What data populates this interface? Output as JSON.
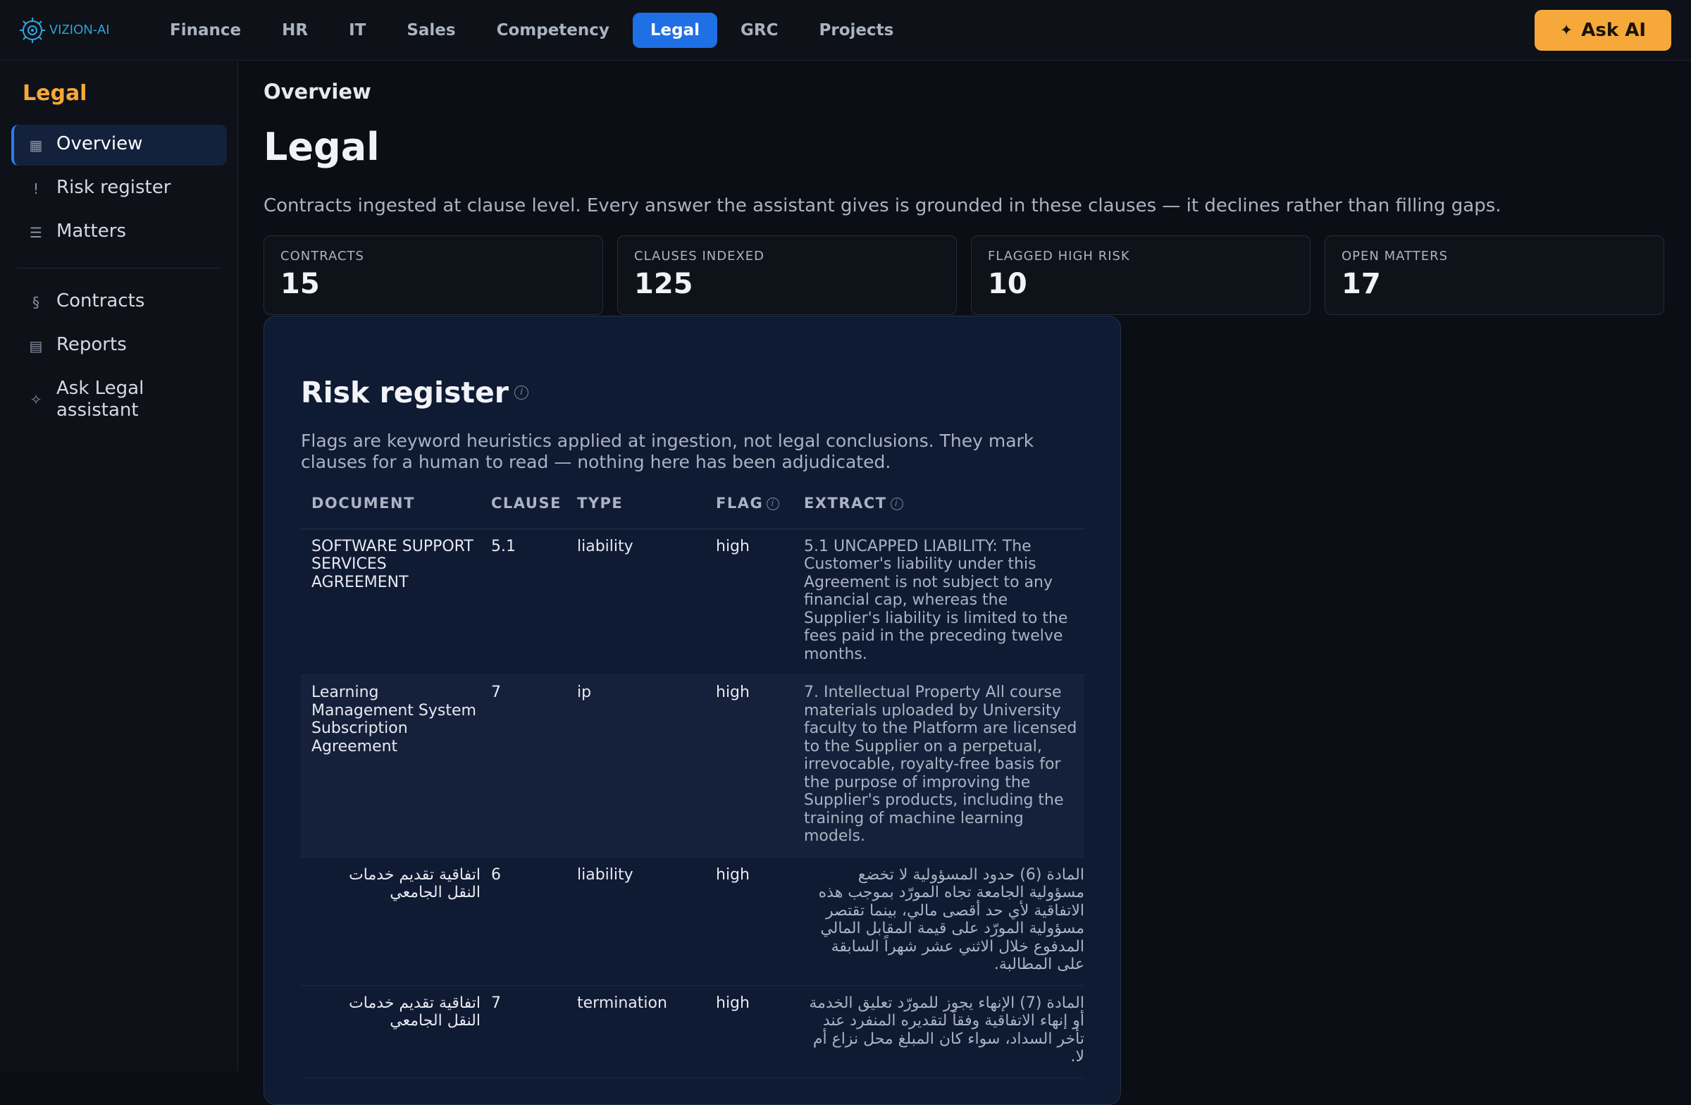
{
  "app": {
    "logo_text": "VIZION-AI"
  },
  "topnav": {
    "items": [
      {
        "label": "Finance"
      },
      {
        "label": "HR"
      },
      {
        "label": "IT"
      },
      {
        "label": "Sales"
      },
      {
        "label": "Competency"
      },
      {
        "label": "Legal",
        "active": true
      },
      {
        "label": "GRC"
      },
      {
        "label": "Projects"
      }
    ],
    "ask_ai_label": "Ask AI",
    "ask_ai_icon": "sparkle-icon"
  },
  "sidebar": {
    "title": "Legal",
    "items": [
      {
        "label": "Overview",
        "icon": "grid-icon",
        "active": true
      },
      {
        "label": "Risk register",
        "icon": "alert-icon"
      },
      {
        "label": "Matters",
        "icon": "list-icon"
      },
      {
        "label": "Contracts",
        "icon": "section-icon"
      },
      {
        "label": "Reports",
        "icon": "report-icon"
      },
      {
        "label": "Ask Legal assistant",
        "icon": "sparkle-icon"
      }
    ]
  },
  "main": {
    "breadcrumb": "Overview",
    "title": "Legal",
    "subtitle": "Contracts ingested at clause level. Every answer the assistant gives is grounded in these clauses — it declines rather than filling gaps.",
    "stats": [
      {
        "label": "CONTRACTS",
        "value": "15"
      },
      {
        "label": "CLAUSES INDEXED",
        "value": "125"
      },
      {
        "label": "FLAGGED HIGH RISK",
        "value": "10"
      },
      {
        "label": "OPEN MATTERS",
        "value": "17"
      }
    ]
  },
  "risk_register": {
    "title": "Risk register",
    "description": "Flags are keyword heuristics applied at ingestion, not legal conclusions. They mark clauses for a human to read — nothing here has been adjudicated.",
    "columns": {
      "document": "DOCUMENT",
      "clause": "CLAUSE",
      "type": "TYPE",
      "flag": "FLAG",
      "extract": "EXTRACT"
    },
    "rows": [
      {
        "document": "SOFTWARE SUPPORT SERVICES AGREEMENT",
        "clause": "5.1",
        "type": "liability",
        "flag": "high",
        "extract": "5.1 UNCAPPED LIABILITY: The Customer's liability under this Agreement is not subject to any financial cap, whereas the Supplier's liability is limited to the fees paid in the preceding twelve months."
      },
      {
        "document": "Learning Management System Subscription Agreement",
        "clause": "7",
        "type": "ip",
        "flag": "high",
        "extract": "7. Intellectual Property All course materials uploaded by University faculty to the Platform are licensed to the Supplier on a perpetual, irrevocable, royalty-free basis for the purpose of improving the Supplier's products, including the training of machine learning models."
      },
      {
        "document": "اتفاقية تقديم خدمات النقل الجامعي",
        "clause": "6",
        "type": "liability",
        "flag": "high",
        "extract": "المادة (6) حدود المسؤولية لا تخضع مسؤولية الجامعة تجاه المورّد بموجب هذه الاتفاقية لأي حد أقصى مالي، بينما تقتصر مسؤولية المورّد على قيمة المقابل المالي المدفوع خلال الاثني عشر شهراً السابقة على المطالبة."
      },
      {
        "document": "اتفاقية تقديم خدمات النقل الجامعي",
        "clause": "7",
        "type": "termination",
        "flag": "high",
        "extract": "المادة (7) الإنهاء يجوز للمورّد تعليق الخدمة أو إنهاء الاتفاقية وفقاً لتقديره المنفرد عند تأخر السداد، سواء كان المبلغ محل نزاع أم لا."
      }
    ]
  }
}
